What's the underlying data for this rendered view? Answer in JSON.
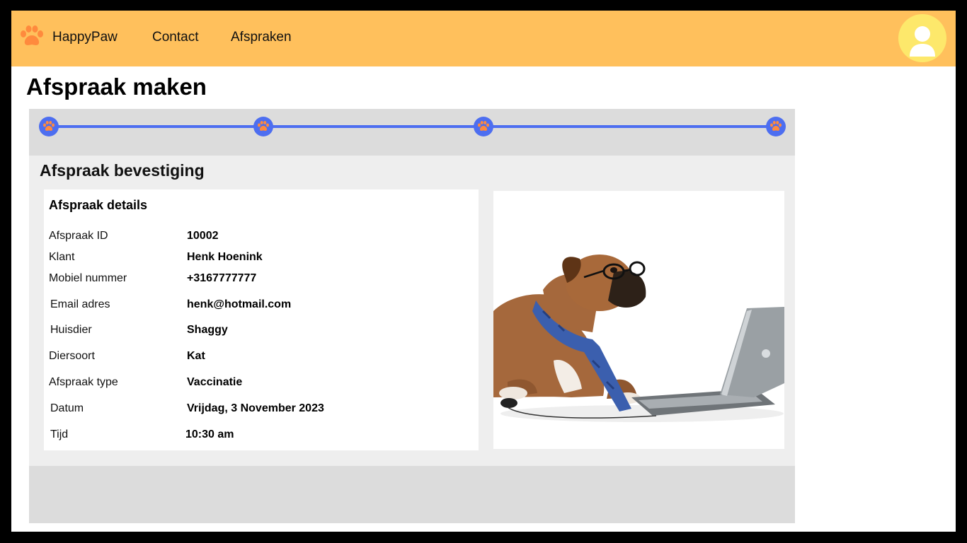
{
  "nav": {
    "brand": "HappyPaw",
    "links": [
      "Contact",
      "Afspraken"
    ]
  },
  "page": {
    "title": "Afspraak maken"
  },
  "stepper": {
    "steps": 4,
    "current_step": 4
  },
  "confirmation": {
    "title": "Afspraak bevestiging",
    "details_title": "Afspraak details",
    "fields": [
      {
        "label": "Afspraak ID",
        "value": "10002"
      },
      {
        "label": "Klant",
        "value": "Henk Hoenink"
      },
      {
        "label": "Mobiel nummer",
        "value": "+3167777777"
      },
      {
        "label": "Email adres",
        "value": "henk@hotmail.com"
      },
      {
        "label": "Huisdier",
        "value": "Shaggy"
      },
      {
        "label": "Diersoort",
        "value": "Kat"
      },
      {
        "label": "Afspraak type",
        "value": "Vaccinatie"
      },
      {
        "label": "Datum",
        "value": "Vrijdag, 3 November 2023"
      },
      {
        "label": "Tijd",
        "value": "10:30 am"
      }
    ]
  },
  "colors": {
    "navbar": "#ffc05c",
    "accent": "#4d6ef0",
    "paw": "#ff8a3d",
    "avatar": "#fde86b"
  },
  "icons": [
    "paw-icon",
    "user-icon"
  ]
}
